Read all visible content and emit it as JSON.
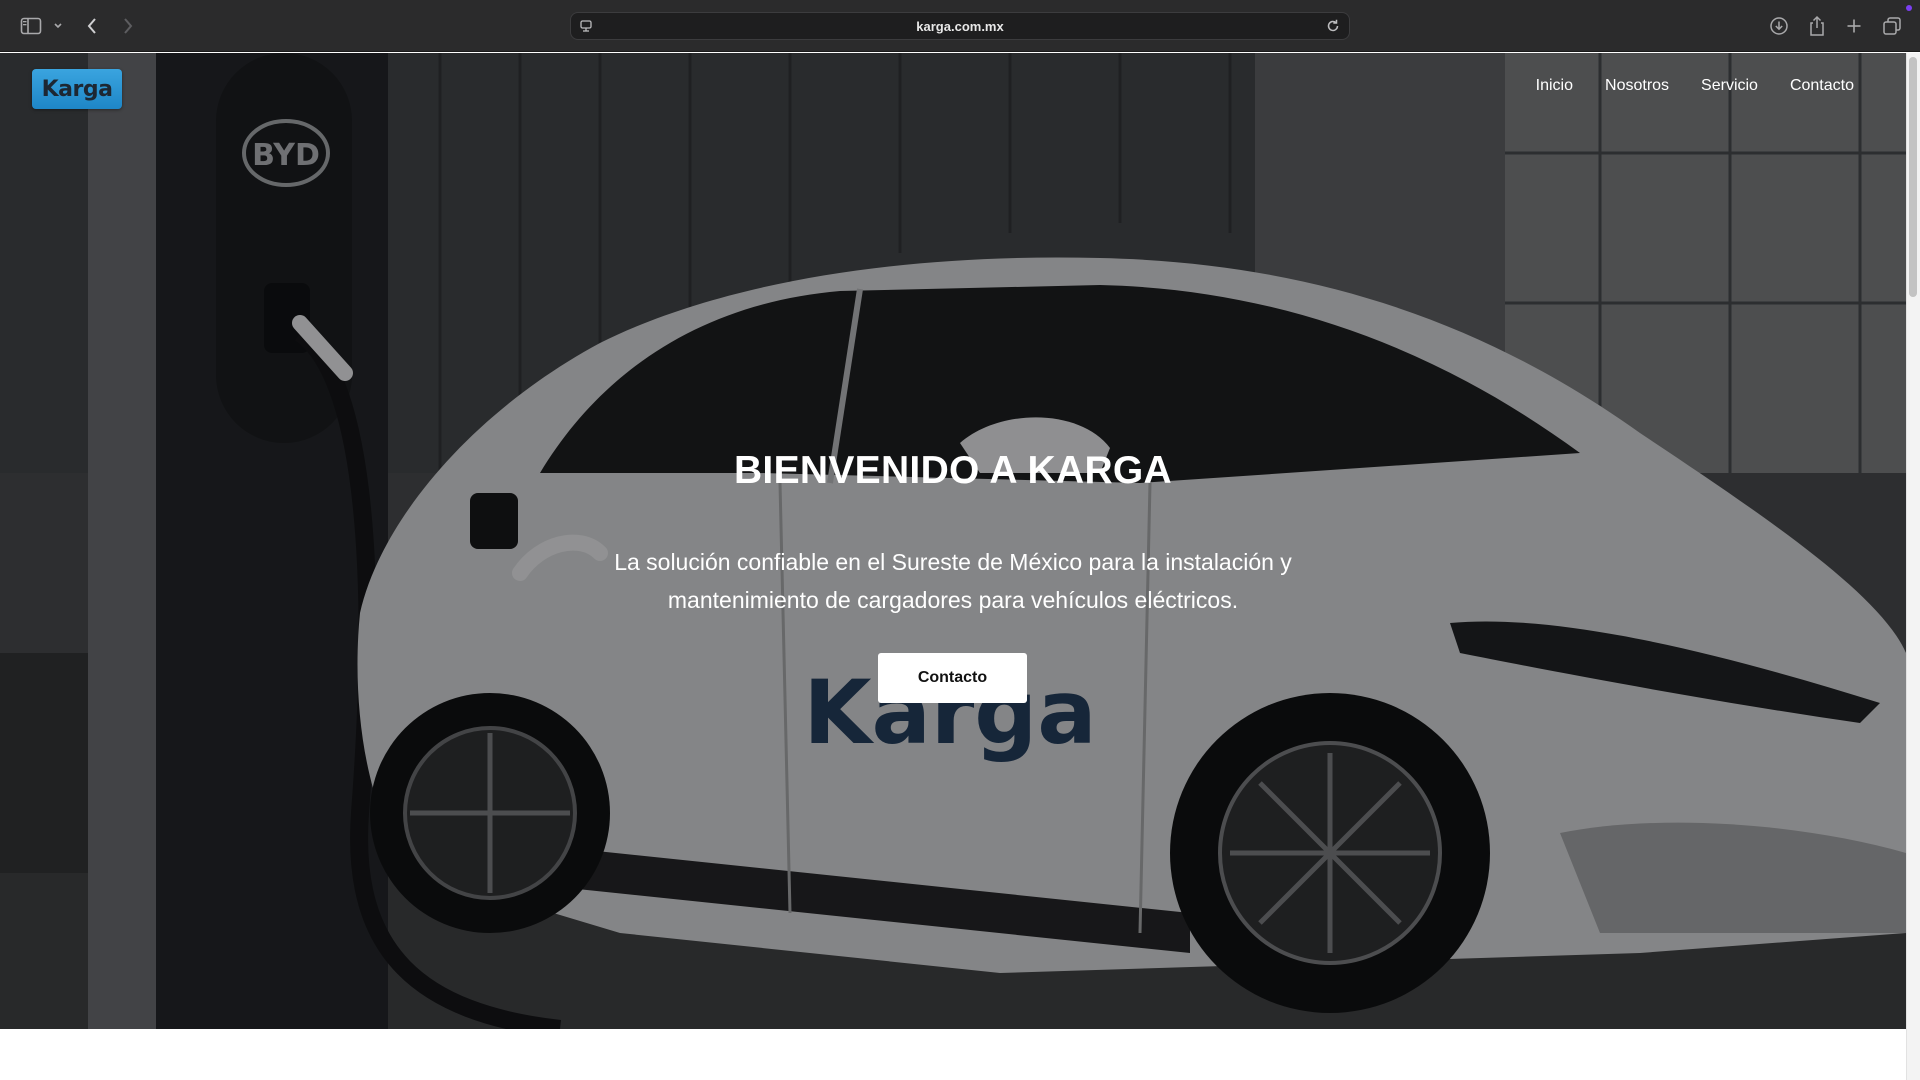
{
  "browser": {
    "url": "karga.com.mx"
  },
  "site": {
    "logo_text": "Karga",
    "nav": [
      "Inicio",
      "Nosotros",
      "Servicio",
      "Contacto"
    ]
  },
  "hero": {
    "title": "BIENVENIDO A KARGA",
    "subtitle_line1": "La solución confiable en el Sureste de México para la instalación y",
    "subtitle_line2": "mantenimiento de cargadores para vehículos eléctricos.",
    "cta_label": "Contacto",
    "charger_logo_text": "BYD",
    "car_decal_text": "Karga"
  },
  "icons": [
    "sidebar-icon",
    "chevron-down-icon",
    "back-icon",
    "forward-icon",
    "site-settings-icon",
    "reload-icon",
    "download-icon",
    "share-icon",
    "new-tab-icon",
    "tab-overview-icon"
  ],
  "colors": {
    "chrome_bg": "#2b2b2c",
    "brand_blue": "#2a95d4",
    "hero_text": "#ffffff",
    "button_bg": "#ffffff"
  }
}
